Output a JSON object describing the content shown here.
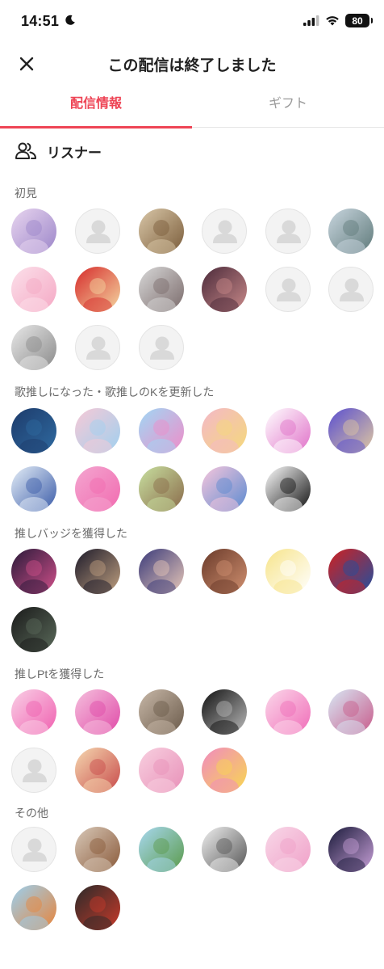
{
  "status_bar": {
    "time": "14:51",
    "battery": "80"
  },
  "header": {
    "title": "この配信は終了しました"
  },
  "tabs": [
    {
      "label": "配信情報",
      "active": true
    },
    {
      "label": "ギフト",
      "active": false
    }
  ],
  "listeners": {
    "label": "リスナー"
  },
  "colors": {
    "accent": "#ee4455",
    "placeholder": "#f3f3f3"
  },
  "sections": [
    {
      "label": "初見",
      "avatars": [
        {
          "kind": "photo",
          "icon": "anime-girl-purple",
          "c1": "#e8d5ef",
          "c2": "#9c86c9"
        },
        {
          "kind": "placeholder",
          "icon": "default-user-icon"
        },
        {
          "kind": "photo",
          "icon": "capybara",
          "c1": "#d9c7a8",
          "c2": "#7a5c3a"
        },
        {
          "kind": "placeholder",
          "icon": "default-user-icon"
        },
        {
          "kind": "placeholder",
          "icon": "default-user-icon"
        },
        {
          "kind": "photo",
          "icon": "landscape-sea",
          "c1": "#c9d6df",
          "c2": "#5f7a7a"
        },
        {
          "kind": "photo",
          "icon": "pink-character",
          "c1": "#fbe0ea",
          "c2": "#f5a8c4"
        },
        {
          "kind": "photo",
          "icon": "gohan-package",
          "c1": "#d62b2b",
          "c2": "#f4d7a1"
        },
        {
          "kind": "photo",
          "icon": "anime-girl-grey",
          "c1": "#d8d8d8",
          "c2": "#7a6a6a"
        },
        {
          "kind": "photo",
          "icon": "person-portrait",
          "c1": "#4b2a3a",
          "c2": "#c98a8a"
        },
        {
          "kind": "placeholder",
          "icon": "default-user-icon"
        },
        {
          "kind": "placeholder",
          "icon": "default-user-icon"
        },
        {
          "kind": "photo",
          "icon": "sketch-drawing",
          "c1": "#e8e8e8",
          "c2": "#8a8a8a"
        },
        {
          "kind": "placeholder",
          "icon": "default-user-icon"
        },
        {
          "kind": "placeholder",
          "icon": "default-user-icon"
        }
      ]
    },
    {
      "label": "歌推しになった・歌推しのKを更新した",
      "avatars": [
        {
          "kind": "photo",
          "icon": "night-sky",
          "c1": "#1d3b6b",
          "c2": "#2f6aa0"
        },
        {
          "kind": "photo",
          "icon": "cute-illustration",
          "c1": "#f7c9d6",
          "c2": "#9fd0ef"
        },
        {
          "kind": "photo",
          "icon": "hiragana-hi",
          "c1": "#9fd8f5",
          "c2": "#f08cc8"
        },
        {
          "kind": "photo",
          "icon": "anime-girl-blonde",
          "c1": "#f3b8c8",
          "c2": "#f5d97a"
        },
        {
          "kind": "photo",
          "icon": "letters-ki",
          "c1": "#ffffff",
          "c2": "#e070c8"
        },
        {
          "kind": "photo",
          "icon": "sunglasses-character",
          "c1": "#5a4fd0",
          "c2": "#e0c8a0"
        },
        {
          "kind": "photo",
          "icon": "anime-character-blue",
          "c1": "#e5eef7",
          "c2": "#3a5ba8"
        },
        {
          "kind": "photo",
          "icon": "hiragana-de",
          "c1": "#f3a6d0",
          "c2": "#f26bb0"
        },
        {
          "kind": "photo",
          "icon": "anime-boy",
          "c1": "#c8e0a0",
          "c2": "#8a6a4a"
        },
        {
          "kind": "photo",
          "icon": "eyes-emoji",
          "c1": "#f7c6dc",
          "c2": "#5a8ad0"
        },
        {
          "kind": "photo",
          "icon": "text-drawing",
          "c1": "#ffffff",
          "c2": "#111111"
        }
      ]
    },
    {
      "label": "推しバッジを獲得した",
      "avatars": [
        {
          "kind": "photo",
          "icon": "fireworks",
          "c1": "#2a1a3a",
          "c2": "#d0508a"
        },
        {
          "kind": "photo",
          "icon": "dark-anime-girl",
          "c1": "#1c1a2a",
          "c2": "#c0a080"
        },
        {
          "kind": "photo",
          "icon": "anime-boy-purple",
          "c1": "#3a3a7a",
          "c2": "#e8c8b8"
        },
        {
          "kind": "photo",
          "icon": "food-table",
          "c1": "#6a3a2a",
          "c2": "#d09070"
        },
        {
          "kind": "photo",
          "icon": "chicken-cartoon",
          "c1": "#f7e48a",
          "c2": "#ffffff"
        },
        {
          "kind": "photo",
          "icon": "kk-store",
          "c1": "#d02020",
          "c2": "#2050a0"
        },
        {
          "kind": "photo",
          "icon": "sake-bottles",
          "c1": "#1a1a1a",
          "c2": "#5a6a5a"
        }
      ]
    },
    {
      "label": "推しPtを獲得した",
      "avatars": [
        {
          "kind": "photo",
          "icon": "hiragana-ru",
          "c1": "#f9d0e6",
          "c2": "#f060b0"
        },
        {
          "kind": "photo",
          "icon": "hiragana-ne",
          "c1": "#f5c0dd",
          "c2": "#e04aa8"
        },
        {
          "kind": "photo",
          "icon": "cat-photo",
          "c1": "#c8b8a8",
          "c2": "#6a5a4a"
        },
        {
          "kind": "photo",
          "icon": "monochrome-photo",
          "c1": "#111111",
          "c2": "#bbbbbb"
        },
        {
          "kind": "photo",
          "icon": "hiragana-ta",
          "c1": "#fbd8ea",
          "c2": "#f06cb8"
        },
        {
          "kind": "photo",
          "icon": "anime-group",
          "c1": "#d8e8f5",
          "c2": "#c85a8a"
        },
        {
          "kind": "placeholder",
          "icon": "default-user-icon"
        },
        {
          "kind": "photo",
          "icon": "anime-girl-flowers",
          "c1": "#f5d8b0",
          "c2": "#c84a4a"
        },
        {
          "kind": "photo",
          "icon": "anime-girl-pink",
          "c1": "#f8d0e0",
          "c2": "#e890b8"
        },
        {
          "kind": "photo",
          "icon": "yellow-character",
          "c1": "#f08ac0",
          "c2": "#f8d850"
        }
      ]
    },
    {
      "label": "その他",
      "avatars": [
        {
          "kind": "placeholder",
          "icon": "default-user-icon"
        },
        {
          "kind": "photo",
          "icon": "figurine",
          "c1": "#d8c8b8",
          "c2": "#8a5a3a"
        },
        {
          "kind": "photo",
          "icon": "mountain-landscape",
          "c1": "#a8d8f0",
          "c2": "#5a9a4a"
        },
        {
          "kind": "photo",
          "icon": "sketch-girl",
          "c1": "#f0f0f0",
          "c2": "#555555"
        },
        {
          "kind": "photo",
          "icon": "anime-girl-pastel",
          "c1": "#f8d8e8",
          "c2": "#f0a0c8"
        },
        {
          "kind": "photo",
          "icon": "dark-illustration",
          "c1": "#1a1a3a",
          "c2": "#c8a0d8"
        },
        {
          "kind": "photo",
          "icon": "cartoon-boy",
          "c1": "#9ad0f0",
          "c2": "#e8843a"
        },
        {
          "kind": "photo",
          "icon": "dragonfly",
          "c1": "#2a2a2a",
          "c2": "#c83a2a"
        }
      ]
    }
  ]
}
